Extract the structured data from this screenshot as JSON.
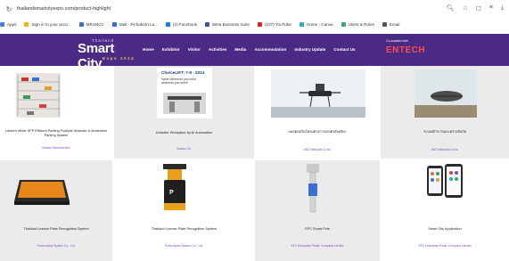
{
  "address_bar": {
    "url": "thailandsmartcityexpo.com/product-highlight",
    "right_icons": [
      "zoom-icon",
      "star-icon",
      "extension-icon",
      "reading-list-icon",
      "download-icon"
    ]
  },
  "bookmarks": [
    {
      "label": "Apps",
      "color": "#4a7cd8"
    },
    {
      "label": "Sign in to your acco...",
      "color": "#f2b400"
    },
    {
      "label": "MRSNCC",
      "color": "#3a6fd0"
    },
    {
      "label": "Mail - Pichakorn La...",
      "color": "#2b76d4"
    },
    {
      "label": "(2) Facebook",
      "color": "#1877f2"
    },
    {
      "label": "Meta Business Suite",
      "color": "#3b5998"
    },
    {
      "label": "(107) YouTube",
      "color": "#e62117"
    },
    {
      "label": "Home - Canva",
      "color": "#2aa9c9"
    },
    {
      "label": "Users & Roles",
      "color": "#3fa56c"
    },
    {
      "label": "Email",
      "color": "#555555"
    }
  ],
  "site": {
    "logo_top": "Thailand",
    "logo_main": "Smart City",
    "logo_sub": "Expo 2024",
    "nav": [
      "Home",
      "Exhibitor",
      "Visitor",
      "Activities",
      "Media",
      "Accommodation",
      "Industry Update",
      "Contact Us"
    ],
    "colocated_label": "Co-located with",
    "colocated_logo": "ENTECH",
    "brand_color": "#4b2a86"
  },
  "products": [
    {
      "title": "Lantern Wider SFP Efficient Parking Pushpal Urbanize & Modernize Parking System",
      "company": "Mawan Mechatronics"
    },
    {
      "title": "Uniwater Workplace by AI Automation",
      "company": "Kaiwon Co.",
      "headline": "ChoiceLIFT: 7-8 - 2024",
      "subline": "Value Wherever you need wherever you need!"
    },
    {
      "title": "แพลตฟอร์มโดรนทางการเกษตรอัจฉริยะ",
      "company": "ANS Networks & Ins."
    },
    {
      "title": "ระบบเฝ้าระวังและตรวจจับภัย",
      "company": "ANS Networks & Ins."
    },
    {
      "title": "Thailand License Plate Recognition System",
      "company": "Porsa Alpha System Co., Ltd."
    },
    {
      "title": "Thailand License Plate Recognition System",
      "company": "Porsa Alpha System Co., Ltd."
    },
    {
      "title": "EPC Smart Pole",
      "company": "EFC Enterprise Public Company Limited"
    },
    {
      "title": "Smart City Application",
      "company": "EFC Enterprise Public Company Limited"
    }
  ]
}
